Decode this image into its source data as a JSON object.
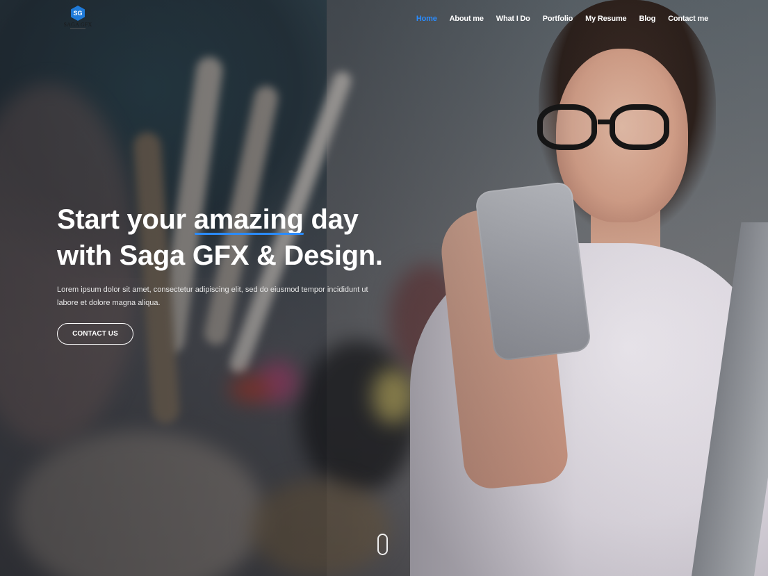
{
  "logo": {
    "mark": "SG",
    "text": "SAGA GFX",
    "icon": "saga-gfx-hexagon-logo"
  },
  "nav": {
    "items": [
      {
        "label": "Home",
        "active": true
      },
      {
        "label": "About me"
      },
      {
        "label": "What I Do"
      },
      {
        "label": "Portfolio"
      },
      {
        "label": "My Resume"
      },
      {
        "label": "Blog"
      },
      {
        "label": "Contact me"
      }
    ]
  },
  "hero": {
    "title_part1": "Start your ",
    "title_highlight": "amazing",
    "title_part2": "day with Saga GFX & Design.",
    "description": "Lorem ipsum dolor sit amet, consectetur adipiscing elit, sed do eiusmod tempor incididunt ut labore et dolore magna aliqua.",
    "cta_label": "CONTACT US"
  },
  "colors": {
    "accent": "#2a8cff",
    "text": "#ffffff"
  },
  "scroll_indicator": {
    "icon": "mouse-scroll-icon"
  }
}
